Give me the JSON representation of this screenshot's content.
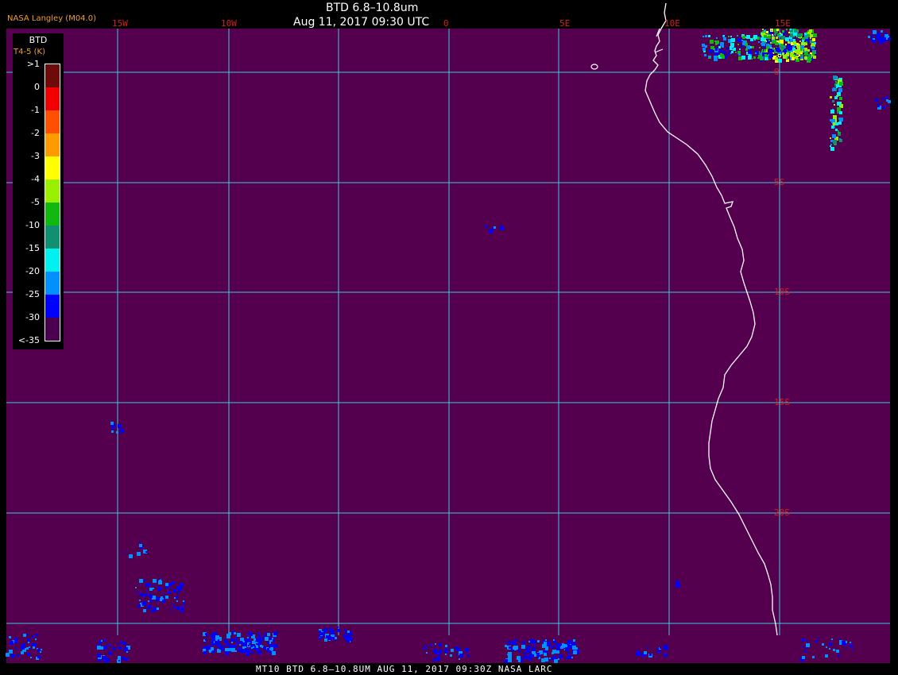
{
  "header": {
    "title": "BTD 6.8–10.8um",
    "datetime": "Aug 11, 2017 09:30 UTC",
    "producer": "NASA Langley (M04.0)"
  },
  "footer": {
    "text": "MT10  BTD 6.8–10.8UM   AUG 11, 2017 09:30Z   NASA LARC"
  },
  "legend": {
    "title": "BTD",
    "subtitle": "T4-5 (K)",
    "ticks": [
      ">1",
      "0",
      "-1",
      "-2",
      "-3",
      "-4",
      "-5",
      "-10",
      "-15",
      "-20",
      "-25",
      "-30",
      "<-35"
    ],
    "colors": [
      "#6e0a0a",
      "#f00000",
      "#ff5000",
      "#ff9a00",
      "#ffff00",
      "#9aee00",
      "#10b810",
      "#109070",
      "#00f0f0",
      "#0090ff",
      "#0000ff",
      "#4b004f"
    ]
  },
  "map": {
    "background_color": "#55004f",
    "grid_color": "#40c8e0",
    "coast_color": "#ffffff",
    "label_color": "#d52020",
    "longitude_labels": [
      "15W",
      "10W",
      "0",
      "5E",
      "10E",
      "15E"
    ],
    "latitude_labels": [
      "0",
      "5S",
      "10S",
      "15S",
      "20S"
    ]
  }
}
